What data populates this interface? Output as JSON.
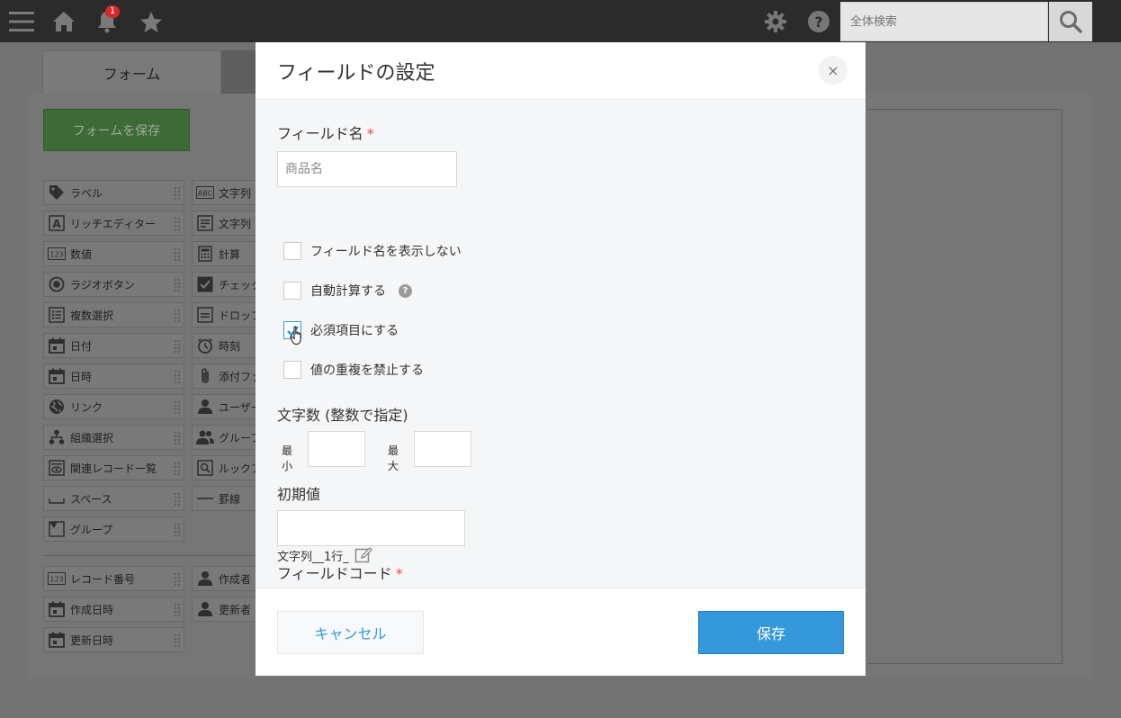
{
  "topbar": {
    "notification_count": "1",
    "search_placeholder": "全体検索"
  },
  "background": {
    "tab_form": "フォーム",
    "save_form_button": "フォームを保存",
    "palette": [
      {
        "label": "ラベル",
        "icon": "tag-icon"
      },
      {
        "label": "文字列（",
        "icon": "abc-icon"
      },
      {
        "label": "リッチエディター",
        "icon": "rich-editor-icon"
      },
      {
        "label": "文字列（",
        "icon": "multiline-text-icon"
      },
      {
        "label": "数値",
        "icon": "number-icon"
      },
      {
        "label": "計算",
        "icon": "calculator-icon"
      },
      {
        "label": "ラジオボタン",
        "icon": "radio-icon"
      },
      {
        "label": "チェック",
        "icon": "checkbox-icon"
      },
      {
        "label": "複数選択",
        "icon": "list-icon"
      },
      {
        "label": "ドロップ",
        "icon": "dropdown-icon"
      },
      {
        "label": "日付",
        "icon": "calendar-icon"
      },
      {
        "label": "時刻",
        "icon": "clock-icon"
      },
      {
        "label": "日時",
        "icon": "calendar-time-icon"
      },
      {
        "label": "添付ファ",
        "icon": "paperclip-icon"
      },
      {
        "label": "リンク",
        "icon": "globe-icon"
      },
      {
        "label": "ユーザー",
        "icon": "user-icon"
      },
      {
        "label": "組織選択",
        "icon": "org-icon"
      },
      {
        "label": "グループ",
        "icon": "users-icon"
      },
      {
        "label": "関連レコード一覧",
        "icon": "related-records-icon"
      },
      {
        "label": "ルックア",
        "icon": "lookup-icon"
      },
      {
        "label": "スペース",
        "icon": "space-icon"
      },
      {
        "label": "罫線",
        "icon": "line-icon"
      },
      {
        "label": "グループ",
        "icon": "group-icon"
      }
    ],
    "palette_system": [
      {
        "label": "レコード番号",
        "icon": "number-icon"
      },
      {
        "label": "作成者",
        "icon": "user-icon"
      },
      {
        "label": "作成日時",
        "icon": "calendar-icon"
      },
      {
        "label": "更新者",
        "icon": "user-icon"
      },
      {
        "label": "更新日時",
        "icon": "calendar-icon"
      }
    ]
  },
  "dialog": {
    "title": "フィールドの設定",
    "close_label": "×",
    "field_name_label": "フィールド名",
    "required_mark": "*",
    "field_name_value": "",
    "field_name_placeholder": "商品名",
    "checkboxes": [
      {
        "label": "フィールド名を表示しない",
        "checked": false
      },
      {
        "label": "自動計算する",
        "checked": false
      },
      {
        "label": "必須項目にする",
        "checked": true
      },
      {
        "label": "値の重複を禁止する",
        "checked": false
      }
    ],
    "help_mark": "?",
    "char_count_label": "文字数 (整数で指定)",
    "min_label": "最小",
    "max_label": "最大",
    "min_value": "",
    "max_value": "",
    "default_value_label": "初期値",
    "default_value": "",
    "field_code_label": "フィールドコード",
    "field_code_value": "文字列__1行_",
    "cancel_button": "キャンセル",
    "save_button": "保存"
  },
  "colors": {
    "accent": "#3498db",
    "required": "#e74c3c",
    "topbar": "#2b2b2b",
    "save_form_green": "#3e6a37"
  }
}
